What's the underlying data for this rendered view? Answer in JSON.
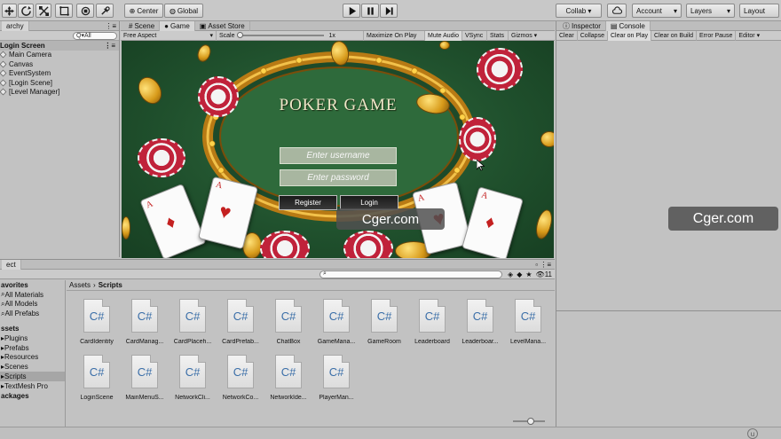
{
  "toolbar": {
    "center_label": "Center",
    "global_label": "Global",
    "collab_label": "Collab ▾",
    "account_label": "Account",
    "layers_label": "Layers",
    "layout_label": "Layout"
  },
  "hierarchy": {
    "tab_label": "archy",
    "search_placeholder": "Q▾All",
    "scene_name": "Login Screen",
    "items": [
      {
        "label": "Main Camera"
      },
      {
        "label": "Canvas"
      },
      {
        "label": "EventSystem"
      },
      {
        "label": "[Login Scene]"
      },
      {
        "label": "[Level Manager]"
      }
    ]
  },
  "scene_tabs": [
    {
      "label": "Scene"
    },
    {
      "label": "Game"
    },
    {
      "label": "Asset Store"
    }
  ],
  "game_bar": {
    "aspect": "Free Aspect",
    "scale_label": "Scale",
    "scale_value": "1x",
    "maximize": "Maximize On Play",
    "mute": "Mute Audio",
    "vsync": "VSync",
    "stats": "Stats",
    "gizmos": "Gizmos ▾"
  },
  "game": {
    "title": "POKER GAME",
    "username_placeholder": "Enter username",
    "password_placeholder": "Enter password",
    "register_label": "Register",
    "login_label": "Login",
    "watermark": "Cger.com"
  },
  "inspector_tabs": [
    {
      "label": "Inspector"
    },
    {
      "label": "Console"
    }
  ],
  "console_bar": [
    {
      "label": "Clear"
    },
    {
      "label": "Collapse"
    },
    {
      "label": "Clear on Play"
    },
    {
      "label": "Clear on Build"
    },
    {
      "label": "Error Pause"
    },
    {
      "label": "Editor ▾"
    }
  ],
  "side_watermark": "Cger.com",
  "project": {
    "tab_label": "ect",
    "badge_count": "11",
    "breadcrumb": [
      "Assets",
      "Scripts"
    ],
    "favorites_heading": "avorites",
    "favorites": [
      {
        "label": "All Materials"
      },
      {
        "label": "All Models"
      },
      {
        "label": "All Prefabs"
      }
    ],
    "assets_heading": "ssets",
    "folders": [
      {
        "label": "Plugins"
      },
      {
        "label": "Prefabs"
      },
      {
        "label": "Resources"
      },
      {
        "label": "Scenes"
      },
      {
        "label": "Scripts"
      },
      {
        "label": "TextMesh Pro"
      }
    ],
    "packages_heading": "ackages",
    "icon_text": "C#",
    "scripts": [
      {
        "label": "CardIdentity"
      },
      {
        "label": "CardManag..."
      },
      {
        "label": "CardPlaceh..."
      },
      {
        "label": "CardPrefab..."
      },
      {
        "label": "ChatBox"
      },
      {
        "label": "GameMana..."
      },
      {
        "label": "GameRoom"
      },
      {
        "label": "Leaderboard"
      },
      {
        "label": "Leaderboar..."
      },
      {
        "label": "LevelMana..."
      },
      {
        "label": "LoginScene"
      },
      {
        "label": "MainMenuS..."
      },
      {
        "label": "NetworkCli..."
      },
      {
        "label": "NetworkCo..."
      },
      {
        "label": "NetworkIde..."
      },
      {
        "label": "PlayerMan..."
      }
    ]
  },
  "colors": {
    "felt": "#2f6a3d",
    "gold": "#d79a1a",
    "chip_red": "#c0223a"
  }
}
